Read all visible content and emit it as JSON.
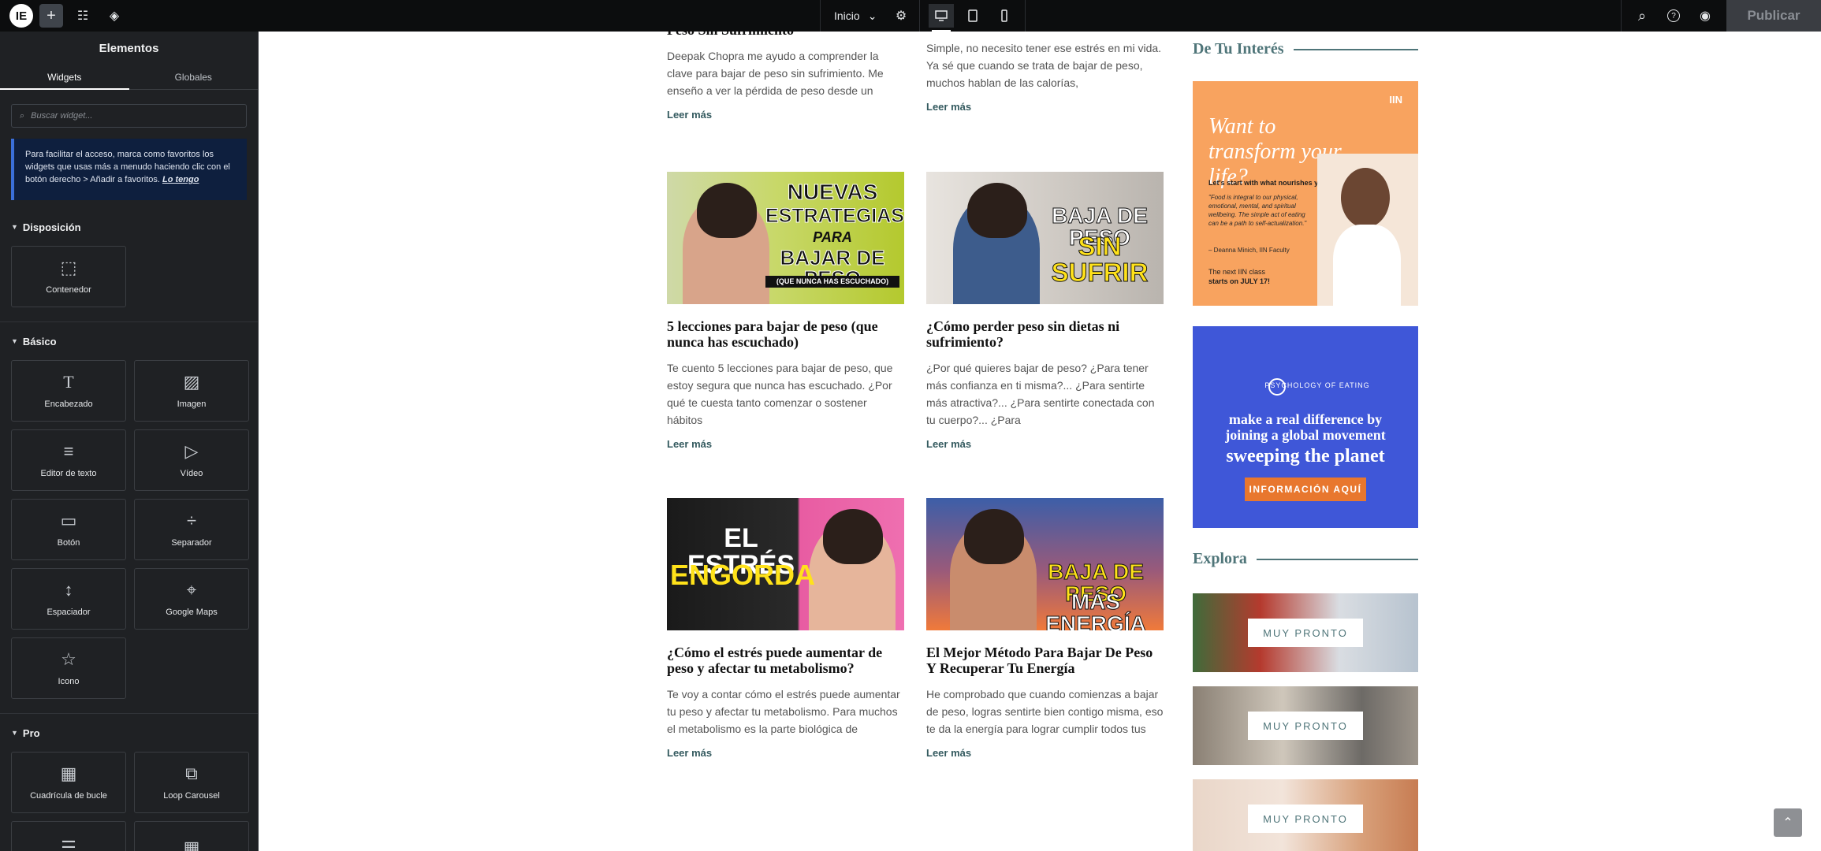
{
  "topbar": {
    "logo": "IE",
    "add_icon": "+",
    "settings_icon": "☷",
    "layers_icon": "◈",
    "page_name": "Inicio",
    "page_chevron": "⌄",
    "page_settings_icon": "⚙",
    "search_icon": "⌕",
    "help_icon": "?",
    "preview_icon": "◉",
    "publish_label": "Publicar"
  },
  "panel": {
    "title": "Elementos",
    "tabs": [
      "Widgets",
      "Globales"
    ],
    "search_placeholder": "Buscar widget...",
    "search_icon": "⌕",
    "notice_text": "Para facilitar el acceso, marca como favoritos los widgets que usas más a menudo haciendo clic con el botón derecho > Añadir a favoritos.",
    "notice_link": "Lo tengo",
    "sections": {
      "layout": {
        "title": "Disposición",
        "widgets": [
          {
            "label": "Contenedor",
            "icon": "⬚"
          }
        ]
      },
      "basic": {
        "title": "Básico",
        "widgets": [
          {
            "label": "Encabezado",
            "icon": "T"
          },
          {
            "label": "Imagen",
            "icon": "▨"
          },
          {
            "label": "Editor de texto",
            "icon": "≡"
          },
          {
            "label": "Vídeo",
            "icon": "▷"
          },
          {
            "label": "Botón",
            "icon": "▭"
          },
          {
            "label": "Separador",
            "icon": "÷"
          },
          {
            "label": "Espaciador",
            "icon": "↕"
          },
          {
            "label": "Google Maps",
            "icon": "⌖"
          },
          {
            "label": "Icono",
            "icon": "☆"
          }
        ]
      },
      "pro": {
        "title": "Pro",
        "widgets": [
          {
            "label": "Cuadrícula de bucle",
            "icon": "▦"
          },
          {
            "label": "Loop Carousel",
            "icon": "⧉"
          },
          {
            "label": "",
            "icon": "☰"
          },
          {
            "label": "",
            "icon": "▦"
          }
        ]
      }
    },
    "collapse_icon": "‹"
  },
  "posts": {
    "top_left": {
      "title": "Peso Sin Sufrimiento",
      "excerpt": "Deepak Chopra me ayudo a comprender la clave para bajar de peso sin sufrimiento. Me enseño a ver la pérdida de peso desde un",
      "more": "Leer más"
    },
    "top_right": {
      "excerpt": "Simple, no necesito tener ese estrés en mi vida. Ya sé que cuando se trata de bajar de peso, muchos hablan de las calorías,",
      "more": "Leer más"
    },
    "items": [
      {
        "thumb_line1": "NUEVAS",
        "thumb_line2": "ESTRATEGIAS",
        "thumb_line3": "PARA",
        "thumb_line4": "BAJAR DE PESO",
        "thumb_line5": "(QUE NUNCA HAS ESCUCHADO)",
        "title": "5 lecciones para bajar de peso (que nunca has escuchado)",
        "excerpt": "Te cuento 5 lecciones para bajar de peso, que estoy segura que nunca has escuchado. ¿Por qué te cuesta tanto comenzar o sostener hábitos",
        "more": "Leer más"
      },
      {
        "thumb_line1": "BAJA DE PESO",
        "thumb_line2": "SIN SUFRIR",
        "title": "¿Cómo perder peso sin dietas ni sufrimiento?",
        "excerpt": "¿Por qué quieres bajar de peso? ¿Para tener más confianza en ti misma?... ¿Para sentirte más atractiva?... ¿Para sentirte conectada con tu cuerpo?... ¿Para",
        "more": "Leer más"
      },
      {
        "thumb_line1": "EL ESTRÉS",
        "thumb_line2": "ENGORDA",
        "title": "¿Cómo el estrés puede aumentar de peso y afectar tu metabolismo?",
        "excerpt": "Te voy a contar cómo el estrés puede aumentar tu peso y afectar tu metabolismo. Para muchos el metabolismo es la parte biológica de",
        "more": "Leer más"
      },
      {
        "thumb_line1": "BAJA DE PESO",
        "thumb_line2": "MÁS ENERGÍA",
        "title": "El Mejor Método Para Bajar De Peso Y Recuperar Tu Energía",
        "excerpt": "He comprobado que cuando comienzas a bajar de peso, logras sentirte bien contigo misma, eso te da la energía para lograr cumplir todos tus",
        "more": "Leer más"
      }
    ]
  },
  "sidebar": {
    "interest_heading": "De Tu Interés",
    "ad1": {
      "brand": "IIN",
      "headline": "Want to transform your life?",
      "sub": "Let's start with what nourishes you.",
      "quote": "\"Food is integral to our physical, emotional, mental, and spiritual wellbeing. The simple act of eating can be a path to self-actualization.\"",
      "author": "– Deanna Minich, IIN Faculty",
      "next_line": "The next IIN class",
      "next_date": "starts on JULY 17!"
    },
    "ad2": {
      "brand": "PSYCHOLOGY OF EATING",
      "line1": "make a real difference by joining a global movement",
      "line2": "sweeping the planet",
      "cta": "INFORMACIÓN AQUÍ"
    },
    "explore_heading": "Explora",
    "explore_items": [
      {
        "badge": "MUY PRONTO"
      },
      {
        "badge": "MUY PRONTO"
      },
      {
        "badge": "MUY PRONTO"
      }
    ]
  },
  "scroll_top_icon": "⌃",
  "colors": {
    "topbar": "#0c0d0e",
    "panel": "#1f2124",
    "accent_teal": "#4f7579",
    "link": "#345a5f",
    "ad_orange": "#f8a35f",
    "ad_blue": "#3f57d8",
    "cta_orange": "#e8772e"
  }
}
